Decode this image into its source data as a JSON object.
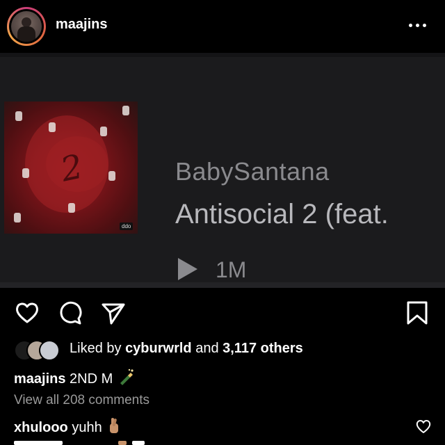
{
  "post": {
    "username": "maajins",
    "more_icon": "more-horizontal-icon"
  },
  "media": {
    "artist": "BabySantana",
    "track_title": "Antisocial 2 (feat.",
    "play_count": "1M",
    "cover_number": "2",
    "cover_label": "ddo",
    "play_icon": "play-icon"
  },
  "actions": {
    "like_icon": "heart-icon",
    "comment_icon": "comment-bubble-icon",
    "share_icon": "paper-plane-icon",
    "save_icon": "bookmark-icon"
  },
  "likes": {
    "prefix": "Liked by ",
    "user": "cyburwrld",
    "middle": " and ",
    "count": "3,117 others"
  },
  "caption": {
    "username": "maajins",
    "text": "2ND M",
    "emoji_icon": "champagne-bottle-icon"
  },
  "comments": {
    "view_all": "View all 208 comments",
    "items": [
      {
        "username": "xhulooo",
        "text": "yuhh",
        "emoji_icon": "crossed-fingers-icon"
      }
    ]
  },
  "colors": {
    "background": "#000000",
    "media_background": "#1b1b1d",
    "muted_text": "#9a9a9a",
    "cover_red": "#8e1a1d"
  }
}
